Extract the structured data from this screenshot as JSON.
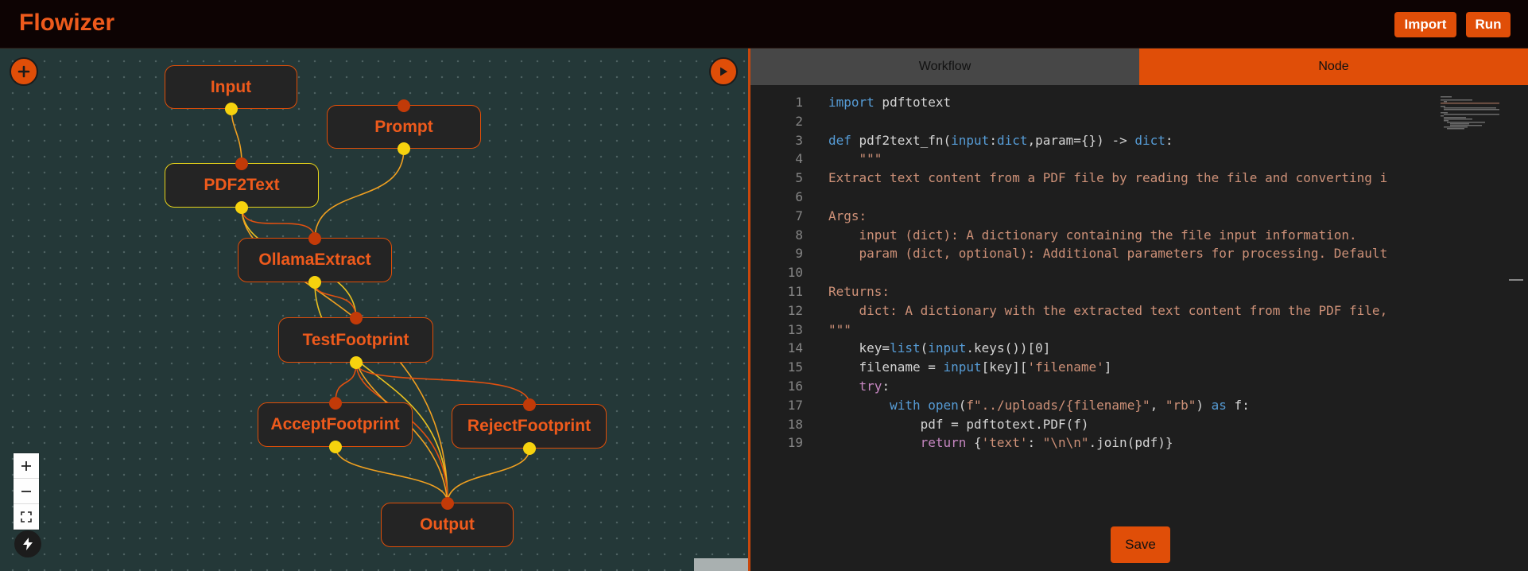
{
  "app": {
    "title": "Flowizer"
  },
  "header": {
    "import_label": "Import",
    "run_label": "Run"
  },
  "canvas": {
    "nodes": [
      {
        "id": "input",
        "label": "Input"
      },
      {
        "id": "prompt",
        "label": "Prompt"
      },
      {
        "id": "pdf2text",
        "label": "PDF2Text"
      },
      {
        "id": "ollamaextract",
        "label": "OllamaExtract"
      },
      {
        "id": "testfootprint",
        "label": "TestFootprint"
      },
      {
        "id": "acceptfootprint",
        "label": "AcceptFootprint"
      },
      {
        "id": "rejectfootprint",
        "label": "RejectFootprint"
      },
      {
        "id": "output",
        "label": "Output"
      }
    ],
    "selected_node": "PDF2Text",
    "colors": {
      "accent": "#e04e08",
      "output_handle": "#f6d20e",
      "input_handle": "#c23a08",
      "canvas_bg": "#243838"
    }
  },
  "panel": {
    "tabs": [
      "Workflow",
      "Node"
    ],
    "active_tab": "Node",
    "save_label": "Save",
    "code_lines": [
      "import pdftotext",
      "",
      "def pdf2text_fn(input:dict,param={}) -> dict:",
      "    \"\"\"",
      "Extract text content from a PDF file by reading the file and converting i",
      "",
      "Args:",
      "    input (dict): A dictionary containing the file input information.",
      "    param (dict, optional): Additional parameters for processing. Default",
      "",
      "Returns:",
      "    dict: A dictionary with the extracted text content from the PDF file,",
      "\"\"\"",
      "    key=list(input.keys())[0]",
      "    filename = input[key]['filename']",
      "    try:",
      "        with open(f\"../uploads/{filename}\", \"rb\") as f:",
      "            pdf = pdftotext.PDF(f)",
      "            return {'text': \"\\n\\n\".join(pdf)}"
    ],
    "line_numbers": [
      "1",
      "2",
      "3",
      "4",
      "5",
      "6",
      "7",
      "8",
      "9",
      "10",
      "11",
      "12",
      "13",
      "14",
      "15",
      "16",
      "17",
      "18",
      "19"
    ]
  }
}
